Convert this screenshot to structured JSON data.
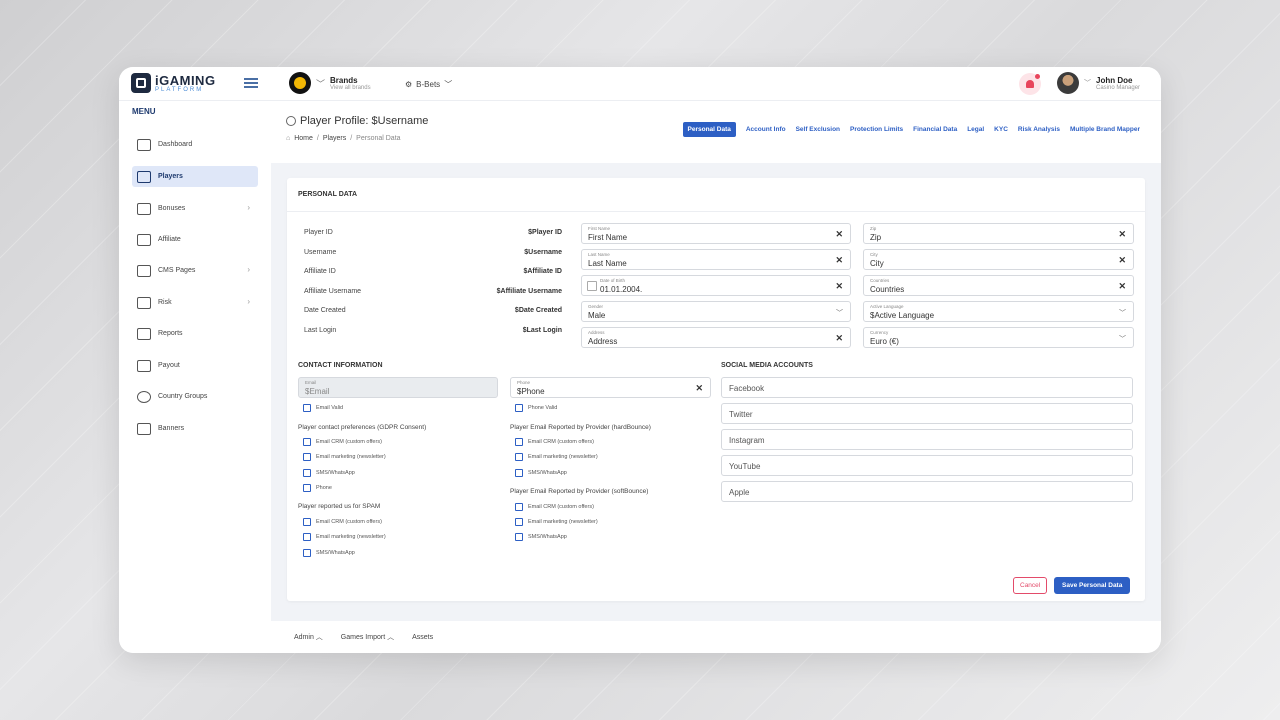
{
  "topbar": {
    "logo_title": "iGAMING",
    "logo_sub": "PLATFORM",
    "brands_title": "Brands",
    "brands_sub": "View all brands",
    "bbets": "B-Bets",
    "user_name": "John Doe",
    "user_role": "Casino Manager"
  },
  "sidebar": {
    "menu_title": "MENU",
    "items": [
      {
        "label": "Dashboard",
        "icon": "home-icon",
        "arrow": false
      },
      {
        "label": "Players",
        "icon": "players-icon",
        "arrow": false,
        "active": true
      },
      {
        "label": "Bonuses",
        "icon": "diamond-icon",
        "arrow": true
      },
      {
        "label": "Affiliate",
        "icon": "sitemap-icon",
        "arrow": false
      },
      {
        "label": "CMS Pages",
        "icon": "cms-icon",
        "arrow": true
      },
      {
        "label": "Risk",
        "icon": "warning-icon",
        "arrow": true
      },
      {
        "label": "Reports",
        "icon": "report-icon",
        "arrow": false
      },
      {
        "label": "Payout",
        "icon": "wallet-icon",
        "arrow": false
      },
      {
        "label": "Country Groups",
        "icon": "globe-icon",
        "arrow": false
      },
      {
        "label": "Banners",
        "icon": "banner-icon",
        "arrow": false
      }
    ]
  },
  "page": {
    "title": "Player Profile: $Username",
    "breadcrumb": [
      "Home",
      "Players",
      "Personal Data"
    ]
  },
  "tabs": [
    "Personal Data",
    "Account Info",
    "Self Exclusion",
    "Protection Limits",
    "Financial Data",
    "Legal",
    "KYC",
    "Risk Analysis",
    "Multiple Brand Mapper"
  ],
  "card": {
    "title": "PERSONAL DATA",
    "details": [
      {
        "label": "Player ID",
        "value": "$Player ID"
      },
      {
        "label": "Username",
        "value": "$Username"
      },
      {
        "label": "Affiliate ID",
        "value": "$Affiliate ID"
      },
      {
        "label": "Affiliate Username",
        "value": "$Affiliate Username"
      },
      {
        "label": "Date Created",
        "value": "$Date Created"
      },
      {
        "label": "Last Login",
        "value": "$Last Login"
      }
    ],
    "fields_left": [
      {
        "label": "First Name",
        "value": "First Name",
        "type": "clear"
      },
      {
        "label": "Last Name",
        "value": "Last Name",
        "type": "clear"
      },
      {
        "label": "Date of Birth",
        "value": "01.01.2004.",
        "type": "date"
      },
      {
        "label": "Gender",
        "value": "Male",
        "type": "select"
      },
      {
        "label": "Address",
        "value": "Address",
        "type": "clear"
      }
    ],
    "fields_right": [
      {
        "label": "Zip",
        "value": "Zip",
        "type": "clear"
      },
      {
        "label": "City",
        "value": "City",
        "type": "clear"
      },
      {
        "label": "Countries",
        "value": "Countries",
        "type": "clear"
      },
      {
        "label": "Active Language",
        "value": "$Active Language",
        "type": "select"
      },
      {
        "label": "Currency",
        "value": "Euro (€)",
        "type": "select"
      }
    ],
    "contact": {
      "title": "CONTACT INFORMATION",
      "email_label": "Email",
      "email_value": "$Email",
      "phone_label": "Phone",
      "phone_value": "$Phone",
      "email_valid": "Email Valid",
      "phone_valid": "Phone Valid",
      "gdpr_title": "Player contact preferences (GDPR Consent)",
      "gdpr_items": [
        "Email CRM (custom offers)",
        "Email marketing (newsletter)",
        "SMS/WhatsApp",
        "Phone"
      ],
      "spam_title": "Player reported us for SPAM",
      "spam_items": [
        "Email CRM (custom offers)",
        "Email marketing (newsletter)",
        "SMS/WhatsApp"
      ],
      "hard_title": "Player Email Reported by Provider (hardBounce)",
      "hard_items": [
        "Email CRM (custom offers)",
        "Email marketing (newsletter)",
        "SMS/WhatsApp"
      ],
      "soft_title": "Player Email Reported by Provider (softBounce)",
      "soft_items": [
        "Email CRM (custom offers)",
        "Email marketing (newsletter)",
        "SMS/WhatsApp"
      ]
    },
    "social": {
      "title": "SOCIAL MEDIA ACCOUNTS",
      "placeholders": [
        "Facebook",
        "Twitter",
        "Instagram",
        "YouTube",
        "Apple"
      ]
    },
    "cancel_label": "Cancel",
    "save_label": "Save Personal Data"
  },
  "footer": [
    "Admin",
    "Games Import",
    "Assets"
  ],
  "colors": {
    "accent": "#2d5fc4",
    "danger": "#e34b6a",
    "brand_dark": "#1e2a40"
  }
}
